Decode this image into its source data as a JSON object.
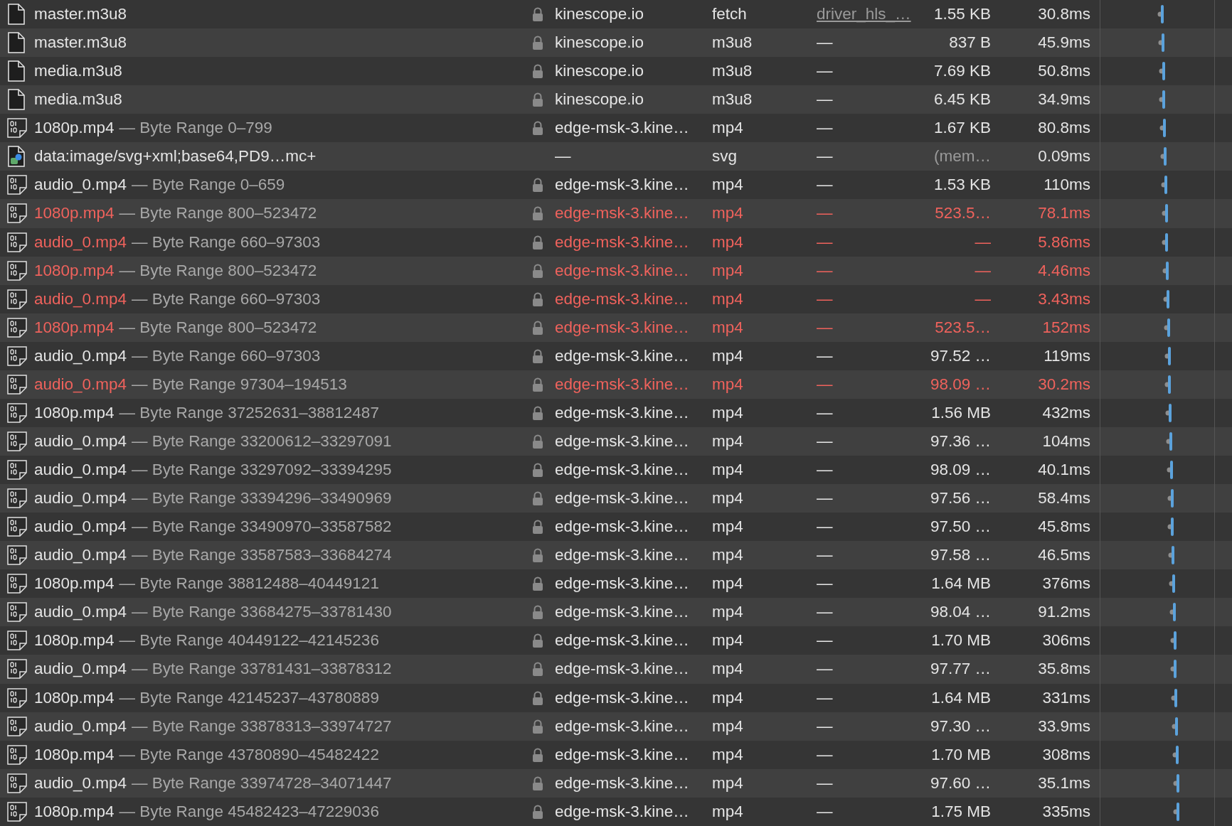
{
  "rows": [
    {
      "kind": "document",
      "name": "master.m3u8",
      "secure": true,
      "domain": "kinescope.io",
      "type": "fetch",
      "initiator": "driver_hls_…",
      "initiator_link": true,
      "size": "1.55 KB",
      "time": "30.8ms",
      "error": false,
      "cached": false
    },
    {
      "kind": "document",
      "name": "master.m3u8",
      "secure": true,
      "domain": "kinescope.io",
      "type": "m3u8",
      "initiator": "—",
      "initiator_link": false,
      "size": "837 B",
      "time": "45.9ms",
      "error": false,
      "cached": false
    },
    {
      "kind": "document",
      "name": "media.m3u8",
      "secure": true,
      "domain": "kinescope.io",
      "type": "m3u8",
      "initiator": "—",
      "initiator_link": false,
      "size": "7.69 KB",
      "time": "50.8ms",
      "error": false,
      "cached": false
    },
    {
      "kind": "document",
      "name": "media.m3u8",
      "secure": true,
      "domain": "kinescope.io",
      "type": "m3u8",
      "initiator": "—",
      "initiator_link": false,
      "size": "6.45 KB",
      "time": "34.9ms",
      "error": false,
      "cached": false
    },
    {
      "kind": "binary",
      "name": "1080p.mp4",
      "range": "— Byte Range 0–799",
      "secure": true,
      "domain": "edge-msk-3.kine…",
      "type": "mp4",
      "initiator": "—",
      "initiator_link": false,
      "size": "1.67 KB",
      "time": "80.8ms",
      "error": false,
      "cached": false
    },
    {
      "kind": "image",
      "name": "data:image/svg+xml;base64,PD9…mc+",
      "secure": false,
      "domain": "—",
      "type": "svg",
      "initiator": "—",
      "initiator_link": false,
      "size": "(mem…",
      "time": "0.09ms",
      "error": false,
      "cached": true
    },
    {
      "kind": "binary",
      "name": "audio_0.mp4",
      "range": "— Byte Range 0–659",
      "secure": true,
      "domain": "edge-msk-3.kine…",
      "type": "mp4",
      "initiator": "—",
      "initiator_link": false,
      "size": "1.53 KB",
      "time": "110ms",
      "error": false,
      "cached": false
    },
    {
      "kind": "binary",
      "name": "1080p.mp4",
      "range": "— Byte Range 800–523472",
      "secure": true,
      "domain": "edge-msk-3.kine…",
      "type": "mp4",
      "initiator": "—",
      "initiator_link": false,
      "size": "523.5…",
      "time": "78.1ms",
      "error": true,
      "cached": false
    },
    {
      "kind": "binary",
      "name": "audio_0.mp4",
      "range": "— Byte Range 660–97303",
      "secure": true,
      "domain": "edge-msk-3.kine…",
      "type": "mp4",
      "initiator": "—",
      "initiator_link": false,
      "size": "—",
      "time": "5.86ms",
      "error": true,
      "cached": false
    },
    {
      "kind": "binary",
      "name": "1080p.mp4",
      "range": "— Byte Range 800–523472",
      "secure": true,
      "domain": "edge-msk-3.kine…",
      "type": "mp4",
      "initiator": "—",
      "initiator_link": false,
      "size": "—",
      "time": "4.46ms",
      "error": true,
      "cached": false
    },
    {
      "kind": "binary",
      "name": "audio_0.mp4",
      "range": "— Byte Range 660–97303",
      "secure": true,
      "domain": "edge-msk-3.kine…",
      "type": "mp4",
      "initiator": "—",
      "initiator_link": false,
      "size": "—",
      "time": "3.43ms",
      "error": true,
      "cached": false
    },
    {
      "kind": "binary",
      "name": "1080p.mp4",
      "range": "— Byte Range 800–523472",
      "secure": true,
      "domain": "edge-msk-3.kine…",
      "type": "mp4",
      "initiator": "—",
      "initiator_link": false,
      "size": "523.5…",
      "time": "152ms",
      "error": true,
      "cached": false
    },
    {
      "kind": "binary",
      "name": "audio_0.mp4",
      "range": "— Byte Range 660–97303",
      "secure": true,
      "domain": "edge-msk-3.kine…",
      "type": "mp4",
      "initiator": "—",
      "initiator_link": false,
      "size": "97.52 …",
      "time": "119ms",
      "error": false,
      "cached": false
    },
    {
      "kind": "binary",
      "name": "audio_0.mp4",
      "range": "— Byte Range 97304–194513",
      "secure": true,
      "domain": "edge-msk-3.kine…",
      "type": "mp4",
      "initiator": "—",
      "initiator_link": false,
      "size": "98.09 …",
      "time": "30.2ms",
      "error": true,
      "cached": false
    },
    {
      "kind": "binary",
      "name": "1080p.mp4",
      "range": "— Byte Range 37252631–38812487",
      "secure": true,
      "domain": "edge-msk-3.kine…",
      "type": "mp4",
      "initiator": "—",
      "initiator_link": false,
      "size": "1.56 MB",
      "time": "432ms",
      "error": false,
      "cached": false
    },
    {
      "kind": "binary",
      "name": "audio_0.mp4",
      "range": "— Byte Range 33200612–33297091",
      "secure": true,
      "domain": "edge-msk-3.kine…",
      "type": "mp4",
      "initiator": "—",
      "initiator_link": false,
      "size": "97.36 …",
      "time": "104ms",
      "error": false,
      "cached": false
    },
    {
      "kind": "binary",
      "name": "audio_0.mp4",
      "range": "— Byte Range 33297092–33394295",
      "secure": true,
      "domain": "edge-msk-3.kine…",
      "type": "mp4",
      "initiator": "—",
      "initiator_link": false,
      "size": "98.09 …",
      "time": "40.1ms",
      "error": false,
      "cached": false
    },
    {
      "kind": "binary",
      "name": "audio_0.mp4",
      "range": "— Byte Range 33394296–33490969",
      "secure": true,
      "domain": "edge-msk-3.kine…",
      "type": "mp4",
      "initiator": "—",
      "initiator_link": false,
      "size": "97.56 …",
      "time": "58.4ms",
      "error": false,
      "cached": false
    },
    {
      "kind": "binary",
      "name": "audio_0.mp4",
      "range": "— Byte Range 33490970–33587582",
      "secure": true,
      "domain": "edge-msk-3.kine…",
      "type": "mp4",
      "initiator": "—",
      "initiator_link": false,
      "size": "97.50 …",
      "time": "45.8ms",
      "error": false,
      "cached": false
    },
    {
      "kind": "binary",
      "name": "audio_0.mp4",
      "range": "— Byte Range 33587583–33684274",
      "secure": true,
      "domain": "edge-msk-3.kine…",
      "type": "mp4",
      "initiator": "—",
      "initiator_link": false,
      "size": "97.58 …",
      "time": "46.5ms",
      "error": false,
      "cached": false
    },
    {
      "kind": "binary",
      "name": "1080p.mp4",
      "range": "— Byte Range 38812488–40449121",
      "secure": true,
      "domain": "edge-msk-3.kine…",
      "type": "mp4",
      "initiator": "—",
      "initiator_link": false,
      "size": "1.64 MB",
      "time": "376ms",
      "error": false,
      "cached": false
    },
    {
      "kind": "binary",
      "name": "audio_0.mp4",
      "range": "— Byte Range 33684275–33781430",
      "secure": true,
      "domain": "edge-msk-3.kine…",
      "type": "mp4",
      "initiator": "—",
      "initiator_link": false,
      "size": "98.04 …",
      "time": "91.2ms",
      "error": false,
      "cached": false
    },
    {
      "kind": "binary",
      "name": "1080p.mp4",
      "range": "— Byte Range 40449122–42145236",
      "secure": true,
      "domain": "edge-msk-3.kine…",
      "type": "mp4",
      "initiator": "—",
      "initiator_link": false,
      "size": "1.70 MB",
      "time": "306ms",
      "error": false,
      "cached": false
    },
    {
      "kind": "binary",
      "name": "audio_0.mp4",
      "range": "— Byte Range 33781431–33878312",
      "secure": true,
      "domain": "edge-msk-3.kine…",
      "type": "mp4",
      "initiator": "—",
      "initiator_link": false,
      "size": "97.77 …",
      "time": "35.8ms",
      "error": false,
      "cached": false
    },
    {
      "kind": "binary",
      "name": "1080p.mp4",
      "range": "— Byte Range 42145237–43780889",
      "secure": true,
      "domain": "edge-msk-3.kine…",
      "type": "mp4",
      "initiator": "—",
      "initiator_link": false,
      "size": "1.64 MB",
      "time": "331ms",
      "error": false,
      "cached": false
    },
    {
      "kind": "binary",
      "name": "audio_0.mp4",
      "range": "— Byte Range 33878313–33974727",
      "secure": true,
      "domain": "edge-msk-3.kine…",
      "type": "mp4",
      "initiator": "—",
      "initiator_link": false,
      "size": "97.30 …",
      "time": "33.9ms",
      "error": false,
      "cached": false
    },
    {
      "kind": "binary",
      "name": "1080p.mp4",
      "range": "— Byte Range 43780890–45482422",
      "secure": true,
      "domain": "edge-msk-3.kine…",
      "type": "mp4",
      "initiator": "—",
      "initiator_link": false,
      "size": "1.70 MB",
      "time": "308ms",
      "error": false,
      "cached": false
    },
    {
      "kind": "binary",
      "name": "audio_0.mp4",
      "range": "— Byte Range 33974728–34071447",
      "secure": true,
      "domain": "edge-msk-3.kine…",
      "type": "mp4",
      "initiator": "—",
      "initiator_link": false,
      "size": "97.60 …",
      "time": "35.1ms",
      "error": false,
      "cached": false
    },
    {
      "kind": "binary",
      "name": "1080p.mp4",
      "range": "— Byte Range 45482423–47229036",
      "secure": true,
      "domain": "edge-msk-3.kine…",
      "type": "mp4",
      "initiator": "—",
      "initiator_link": false,
      "size": "1.75 MB",
      "time": "335ms",
      "error": false,
      "cached": false
    }
  ]
}
